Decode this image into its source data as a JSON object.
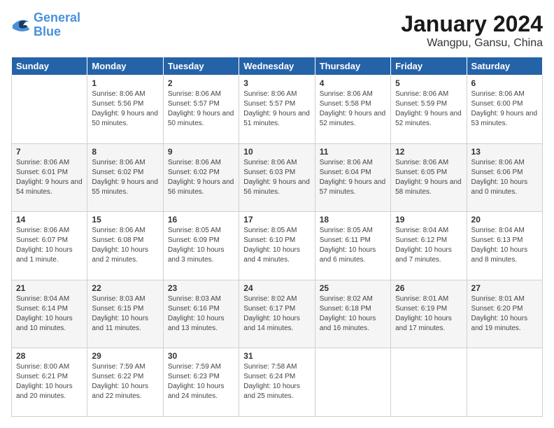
{
  "logo": {
    "line1": "General",
    "line2": "Blue"
  },
  "title": "January 2024",
  "subtitle": "Wangpu, Gansu, China",
  "days_header": [
    "Sunday",
    "Monday",
    "Tuesday",
    "Wednesday",
    "Thursday",
    "Friday",
    "Saturday"
  ],
  "weeks": [
    [
      {
        "day": "",
        "sunrise": "",
        "sunset": "",
        "daylight": ""
      },
      {
        "day": "1",
        "sunrise": "Sunrise: 8:06 AM",
        "sunset": "Sunset: 5:56 PM",
        "daylight": "Daylight: 9 hours and 50 minutes."
      },
      {
        "day": "2",
        "sunrise": "Sunrise: 8:06 AM",
        "sunset": "Sunset: 5:57 PM",
        "daylight": "Daylight: 9 hours and 50 minutes."
      },
      {
        "day": "3",
        "sunrise": "Sunrise: 8:06 AM",
        "sunset": "Sunset: 5:57 PM",
        "daylight": "Daylight: 9 hours and 51 minutes."
      },
      {
        "day": "4",
        "sunrise": "Sunrise: 8:06 AM",
        "sunset": "Sunset: 5:58 PM",
        "daylight": "Daylight: 9 hours and 52 minutes."
      },
      {
        "day": "5",
        "sunrise": "Sunrise: 8:06 AM",
        "sunset": "Sunset: 5:59 PM",
        "daylight": "Daylight: 9 hours and 52 minutes."
      },
      {
        "day": "6",
        "sunrise": "Sunrise: 8:06 AM",
        "sunset": "Sunset: 6:00 PM",
        "daylight": "Daylight: 9 hours and 53 minutes."
      }
    ],
    [
      {
        "day": "7",
        "sunrise": "Sunrise: 8:06 AM",
        "sunset": "Sunset: 6:01 PM",
        "daylight": "Daylight: 9 hours and 54 minutes."
      },
      {
        "day": "8",
        "sunrise": "Sunrise: 8:06 AM",
        "sunset": "Sunset: 6:02 PM",
        "daylight": "Daylight: 9 hours and 55 minutes."
      },
      {
        "day": "9",
        "sunrise": "Sunrise: 8:06 AM",
        "sunset": "Sunset: 6:02 PM",
        "daylight": "Daylight: 9 hours and 56 minutes."
      },
      {
        "day": "10",
        "sunrise": "Sunrise: 8:06 AM",
        "sunset": "Sunset: 6:03 PM",
        "daylight": "Daylight: 9 hours and 56 minutes."
      },
      {
        "day": "11",
        "sunrise": "Sunrise: 8:06 AM",
        "sunset": "Sunset: 6:04 PM",
        "daylight": "Daylight: 9 hours and 57 minutes."
      },
      {
        "day": "12",
        "sunrise": "Sunrise: 8:06 AM",
        "sunset": "Sunset: 6:05 PM",
        "daylight": "Daylight: 9 hours and 58 minutes."
      },
      {
        "day": "13",
        "sunrise": "Sunrise: 8:06 AM",
        "sunset": "Sunset: 6:06 PM",
        "daylight": "Daylight: 10 hours and 0 minutes."
      }
    ],
    [
      {
        "day": "14",
        "sunrise": "Sunrise: 8:06 AM",
        "sunset": "Sunset: 6:07 PM",
        "daylight": "Daylight: 10 hours and 1 minute."
      },
      {
        "day": "15",
        "sunrise": "Sunrise: 8:06 AM",
        "sunset": "Sunset: 6:08 PM",
        "daylight": "Daylight: 10 hours and 2 minutes."
      },
      {
        "day": "16",
        "sunrise": "Sunrise: 8:05 AM",
        "sunset": "Sunset: 6:09 PM",
        "daylight": "Daylight: 10 hours and 3 minutes."
      },
      {
        "day": "17",
        "sunrise": "Sunrise: 8:05 AM",
        "sunset": "Sunset: 6:10 PM",
        "daylight": "Daylight: 10 hours and 4 minutes."
      },
      {
        "day": "18",
        "sunrise": "Sunrise: 8:05 AM",
        "sunset": "Sunset: 6:11 PM",
        "daylight": "Daylight: 10 hours and 6 minutes."
      },
      {
        "day": "19",
        "sunrise": "Sunrise: 8:04 AM",
        "sunset": "Sunset: 6:12 PM",
        "daylight": "Daylight: 10 hours and 7 minutes."
      },
      {
        "day": "20",
        "sunrise": "Sunrise: 8:04 AM",
        "sunset": "Sunset: 6:13 PM",
        "daylight": "Daylight: 10 hours and 8 minutes."
      }
    ],
    [
      {
        "day": "21",
        "sunrise": "Sunrise: 8:04 AM",
        "sunset": "Sunset: 6:14 PM",
        "daylight": "Daylight: 10 hours and 10 minutes."
      },
      {
        "day": "22",
        "sunrise": "Sunrise: 8:03 AM",
        "sunset": "Sunset: 6:15 PM",
        "daylight": "Daylight: 10 hours and 11 minutes."
      },
      {
        "day": "23",
        "sunrise": "Sunrise: 8:03 AM",
        "sunset": "Sunset: 6:16 PM",
        "daylight": "Daylight: 10 hours and 13 minutes."
      },
      {
        "day": "24",
        "sunrise": "Sunrise: 8:02 AM",
        "sunset": "Sunset: 6:17 PM",
        "daylight": "Daylight: 10 hours and 14 minutes."
      },
      {
        "day": "25",
        "sunrise": "Sunrise: 8:02 AM",
        "sunset": "Sunset: 6:18 PM",
        "daylight": "Daylight: 10 hours and 16 minutes."
      },
      {
        "day": "26",
        "sunrise": "Sunrise: 8:01 AM",
        "sunset": "Sunset: 6:19 PM",
        "daylight": "Daylight: 10 hours and 17 minutes."
      },
      {
        "day": "27",
        "sunrise": "Sunrise: 8:01 AM",
        "sunset": "Sunset: 6:20 PM",
        "daylight": "Daylight: 10 hours and 19 minutes."
      }
    ],
    [
      {
        "day": "28",
        "sunrise": "Sunrise: 8:00 AM",
        "sunset": "Sunset: 6:21 PM",
        "daylight": "Daylight: 10 hours and 20 minutes."
      },
      {
        "day": "29",
        "sunrise": "Sunrise: 7:59 AM",
        "sunset": "Sunset: 6:22 PM",
        "daylight": "Daylight: 10 hours and 22 minutes."
      },
      {
        "day": "30",
        "sunrise": "Sunrise: 7:59 AM",
        "sunset": "Sunset: 6:23 PM",
        "daylight": "Daylight: 10 hours and 24 minutes."
      },
      {
        "day": "31",
        "sunrise": "Sunrise: 7:58 AM",
        "sunset": "Sunset: 6:24 PM",
        "daylight": "Daylight: 10 hours and 25 minutes."
      },
      {
        "day": "",
        "sunrise": "",
        "sunset": "",
        "daylight": ""
      },
      {
        "day": "",
        "sunrise": "",
        "sunset": "",
        "daylight": ""
      },
      {
        "day": "",
        "sunrise": "",
        "sunset": "",
        "daylight": ""
      }
    ]
  ]
}
